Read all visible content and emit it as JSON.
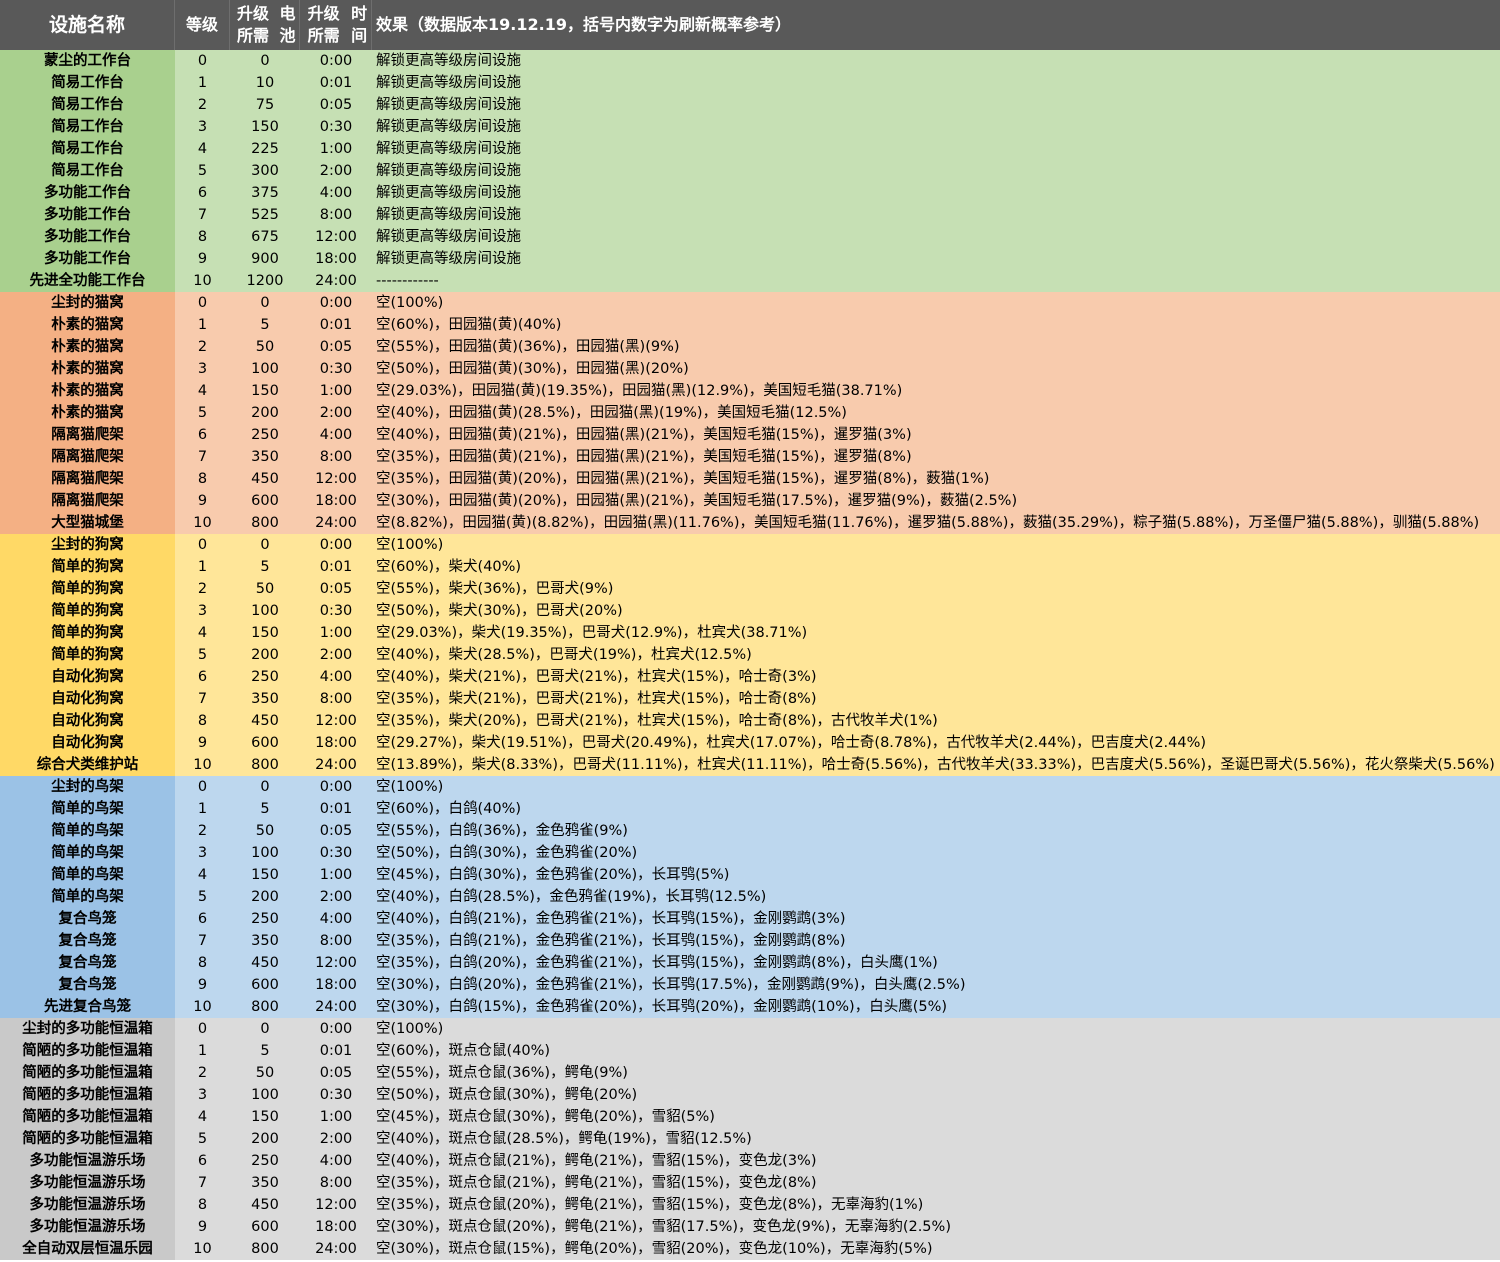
{
  "header": {
    "name": "设施名称",
    "level": "等级",
    "battery_line1": "升级所需",
    "battery_line2": "电池",
    "time_line1": "升级所需",
    "time_line2": "时间",
    "effect": "效果（数据版本19.12.19，括号内数字为刷新概率参考）"
  },
  "groups": [
    {
      "key": "workbench",
      "name_color": "#a9d08e",
      "row_color": "#c6e0b4",
      "rows": [
        {
          "name": "蒙尘的工作台",
          "level": "0",
          "battery": "0",
          "time": "0:00",
          "effect": "解锁更高等级房间设施"
        },
        {
          "name": "简易工作台",
          "level": "1",
          "battery": "10",
          "time": "0:01",
          "effect": "解锁更高等级房间设施"
        },
        {
          "name": "简易工作台",
          "level": "2",
          "battery": "75",
          "time": "0:05",
          "effect": "解锁更高等级房间设施"
        },
        {
          "name": "简易工作台",
          "level": "3",
          "battery": "150",
          "time": "0:30",
          "effect": "解锁更高等级房间设施"
        },
        {
          "name": "简易工作台",
          "level": "4",
          "battery": "225",
          "time": "1:00",
          "effect": "解锁更高等级房间设施"
        },
        {
          "name": "简易工作台",
          "level": "5",
          "battery": "300",
          "time": "2:00",
          "effect": "解锁更高等级房间设施"
        },
        {
          "name": "多功能工作台",
          "level": "6",
          "battery": "375",
          "time": "4:00",
          "effect": "解锁更高等级房间设施"
        },
        {
          "name": "多功能工作台",
          "level": "7",
          "battery": "525",
          "time": "8:00",
          "effect": "解锁更高等级房间设施"
        },
        {
          "name": "多功能工作台",
          "level": "8",
          "battery": "675",
          "time": "12:00",
          "effect": "解锁更高等级房间设施"
        },
        {
          "name": "多功能工作台",
          "level": "9",
          "battery": "900",
          "time": "18:00",
          "effect": "解锁更高等级房间设施"
        },
        {
          "name": "先进全功能工作台",
          "level": "10",
          "battery": "1200",
          "time": "24:00",
          "effect": "------------"
        }
      ]
    },
    {
      "key": "cat",
      "name_color": "#f4b084",
      "row_color": "#f8cbad",
      "rows": [
        {
          "name": "尘封的猫窝",
          "level": "0",
          "battery": "0",
          "time": "0:00",
          "effect": "空(100%)"
        },
        {
          "name": "朴素的猫窝",
          "level": "1",
          "battery": "5",
          "time": "0:01",
          "effect": "空(60%)，田园猫(黄)(40%)"
        },
        {
          "name": "朴素的猫窝",
          "level": "2",
          "battery": "50",
          "time": "0:05",
          "effect": "空(55%)，田园猫(黄)(36%)，田园猫(黑)(9%)"
        },
        {
          "name": "朴素的猫窝",
          "level": "3",
          "battery": "100",
          "time": "0:30",
          "effect": "空(50%)，田园猫(黄)(30%)，田园猫(黑)(20%)"
        },
        {
          "name": "朴素的猫窝",
          "level": "4",
          "battery": "150",
          "time": "1:00",
          "effect": "空(29.03%)，田园猫(黄)(19.35%)，田园猫(黑)(12.9%)，美国短毛猫(38.71%)"
        },
        {
          "name": "朴素的猫窝",
          "level": "5",
          "battery": "200",
          "time": "2:00",
          "effect": "空(40%)，田园猫(黄)(28.5%)，田园猫(黑)(19%)，美国短毛猫(12.5%)"
        },
        {
          "name": "隔离猫爬架",
          "level": "6",
          "battery": "250",
          "time": "4:00",
          "effect": "空(40%)，田园猫(黄)(21%)，田园猫(黑)(21%)，美国短毛猫(15%)，暹罗猫(3%)"
        },
        {
          "name": "隔离猫爬架",
          "level": "7",
          "battery": "350",
          "time": "8:00",
          "effect": "空(35%)，田园猫(黄)(21%)，田园猫(黑)(21%)，美国短毛猫(15%)，暹罗猫(8%)"
        },
        {
          "name": "隔离猫爬架",
          "level": "8",
          "battery": "450",
          "time": "12:00",
          "effect": "空(35%)，田园猫(黄)(20%)，田园猫(黑)(21%)，美国短毛猫(15%)，暹罗猫(8%)，薮猫(1%)"
        },
        {
          "name": "隔离猫爬架",
          "level": "9",
          "battery": "600",
          "time": "18:00",
          "effect": "空(30%)，田园猫(黄)(20%)，田园猫(黑)(21%)，美国短毛猫(17.5%)，暹罗猫(9%)，薮猫(2.5%)"
        },
        {
          "name": "大型猫城堡",
          "level": "10",
          "battery": "800",
          "time": "24:00",
          "effect": "空(8.82%)，田园猫(黄)(8.82%)，田园猫(黑)(11.76%)，美国短毛猫(11.76%)，暹罗猫(5.88%)，薮猫(35.29%)，粽子猫(5.88%)，万圣僵尸猫(5.88%)，驯猫(5.88%)"
        }
      ]
    },
    {
      "key": "dog",
      "name_color": "#ffd966",
      "row_color": "#ffe699",
      "rows": [
        {
          "name": "尘封的狗窝",
          "level": "0",
          "battery": "0",
          "time": "0:00",
          "effect": "空(100%)"
        },
        {
          "name": "简单的狗窝",
          "level": "1",
          "battery": "5",
          "time": "0:01",
          "effect": "空(60%)，柴犬(40%)"
        },
        {
          "name": "简单的狗窝",
          "level": "2",
          "battery": "50",
          "time": "0:05",
          "effect": "空(55%)，柴犬(36%)，巴哥犬(9%)"
        },
        {
          "name": "简单的狗窝",
          "level": "3",
          "battery": "100",
          "time": "0:30",
          "effect": "空(50%)，柴犬(30%)，巴哥犬(20%)"
        },
        {
          "name": "简单的狗窝",
          "level": "4",
          "battery": "150",
          "time": "1:00",
          "effect": "空(29.03%)，柴犬(19.35%)，巴哥犬(12.9%)，杜宾犬(38.71%)"
        },
        {
          "name": "简单的狗窝",
          "level": "5",
          "battery": "200",
          "time": "2:00",
          "effect": "空(40%)，柴犬(28.5%)，巴哥犬(19%)，杜宾犬(12.5%)"
        },
        {
          "name": "自动化狗窝",
          "level": "6",
          "battery": "250",
          "time": "4:00",
          "effect": "空(40%)，柴犬(21%)，巴哥犬(21%)，杜宾犬(15%)，哈士奇(3%)"
        },
        {
          "name": "自动化狗窝",
          "level": "7",
          "battery": "350",
          "time": "8:00",
          "effect": "空(35%)，柴犬(21%)，巴哥犬(21%)，杜宾犬(15%)，哈士奇(8%)"
        },
        {
          "name": "自动化狗窝",
          "level": "8",
          "battery": "450",
          "time": "12:00",
          "effect": "空(35%)，柴犬(20%)，巴哥犬(21%)，杜宾犬(15%)，哈士奇(8%)，古代牧羊犬(1%)"
        },
        {
          "name": "自动化狗窝",
          "level": "9",
          "battery": "600",
          "time": "18:00",
          "effect": "空(29.27%)，柴犬(19.51%)，巴哥犬(20.49%)，杜宾犬(17.07%)，哈士奇(8.78%)，古代牧羊犬(2.44%)，巴吉度犬(2.44%)"
        },
        {
          "name": "综合犬类维护站",
          "level": "10",
          "battery": "800",
          "time": "24:00",
          "effect": "空(13.89%)，柴犬(8.33%)，巴哥犬(11.11%)，杜宾犬(11.11%)，哈士奇(5.56%)，古代牧羊犬(33.33%)，巴吉度犬(5.56%)，圣诞巴哥犬(5.56%)，花火祭柴犬(5.56%)"
        }
      ]
    },
    {
      "key": "bird",
      "name_color": "#9bc2e6",
      "row_color": "#bdd7ee",
      "rows": [
        {
          "name": "尘封的鸟架",
          "level": "0",
          "battery": "0",
          "time": "0:00",
          "effect": "空(100%)"
        },
        {
          "name": "简单的鸟架",
          "level": "1",
          "battery": "5",
          "time": "0:01",
          "effect": "空(60%)，白鸽(40%)"
        },
        {
          "name": "简单的鸟架",
          "level": "2",
          "battery": "50",
          "time": "0:05",
          "effect": "空(55%)，白鸽(36%)，金色鸦雀(9%)"
        },
        {
          "name": "简单的鸟架",
          "level": "3",
          "battery": "100",
          "time": "0:30",
          "effect": "空(50%)，白鸽(30%)，金色鸦雀(20%)"
        },
        {
          "name": "简单的鸟架",
          "level": "4",
          "battery": "150",
          "time": "1:00",
          "effect": "空(45%)，白鸽(30%)，金色鸦雀(20%)，长耳鸮(5%)"
        },
        {
          "name": "简单的鸟架",
          "level": "5",
          "battery": "200",
          "time": "2:00",
          "effect": "空(40%)，白鸽(28.5%)，金色鸦雀(19%)，长耳鸮(12.5%)"
        },
        {
          "name": "复合鸟笼",
          "level": "6",
          "battery": "250",
          "time": "4:00",
          "effect": "空(40%)，白鸽(21%)，金色鸦雀(21%)，长耳鸮(15%)，金刚鹦鹉(3%)"
        },
        {
          "name": "复合鸟笼",
          "level": "7",
          "battery": "350",
          "time": "8:00",
          "effect": "空(35%)，白鸽(21%)，金色鸦雀(21%)，长耳鸮(15%)，金刚鹦鹉(8%)"
        },
        {
          "name": "复合鸟笼",
          "level": "8",
          "battery": "450",
          "time": "12:00",
          "effect": "空(35%)，白鸽(20%)，金色鸦雀(21%)，长耳鸮(15%)，金刚鹦鹉(8%)，白头鹰(1%)"
        },
        {
          "name": "复合鸟笼",
          "level": "9",
          "battery": "600",
          "time": "18:00",
          "effect": "空(30%)，白鸽(20%)，金色鸦雀(21%)，长耳鸮(17.5%)，金刚鹦鹉(9%)，白头鹰(2.5%)"
        },
        {
          "name": "先进复合鸟笼",
          "level": "10",
          "battery": "800",
          "time": "24:00",
          "effect": "空(30%)，白鸽(15%)，金色鸦雀(20%)，长耳鸮(20%)，金刚鹦鹉(10%)，白头鹰(5%)"
        }
      ]
    },
    {
      "key": "terrarium",
      "name_color": "#c9c9c9",
      "row_color": "#dbdbdb",
      "rows": [
        {
          "name": "尘封的多功能恒温箱",
          "level": "0",
          "battery": "0",
          "time": "0:00",
          "effect": "空(100%)"
        },
        {
          "name": "简陋的多功能恒温箱",
          "level": "1",
          "battery": "5",
          "time": "0:01",
          "effect": "空(60%)，斑点仓鼠(40%)"
        },
        {
          "name": "简陋的多功能恒温箱",
          "level": "2",
          "battery": "50",
          "time": "0:05",
          "effect": "空(55%)，斑点仓鼠(36%)，鳄龟(9%)"
        },
        {
          "name": "简陋的多功能恒温箱",
          "level": "3",
          "battery": "100",
          "time": "0:30",
          "effect": "空(50%)，斑点仓鼠(30%)，鳄龟(20%)"
        },
        {
          "name": "简陋的多功能恒温箱",
          "level": "4",
          "battery": "150",
          "time": "1:00",
          "effect": "空(45%)，斑点仓鼠(30%)，鳄龟(20%)，雪貂(5%)"
        },
        {
          "name": "简陋的多功能恒温箱",
          "level": "5",
          "battery": "200",
          "time": "2:00",
          "effect": "空(40%)，斑点仓鼠(28.5%)，鳄龟(19%)，雪貂(12.5%)"
        },
        {
          "name": "多功能恒温游乐场",
          "level": "6",
          "battery": "250",
          "time": "4:00",
          "effect": "空(40%)，斑点仓鼠(21%)，鳄龟(21%)，雪貂(15%)，变色龙(3%)"
        },
        {
          "name": "多功能恒温游乐场",
          "level": "7",
          "battery": "350",
          "time": "8:00",
          "effect": "空(35%)，斑点仓鼠(21%)，鳄龟(21%)，雪貂(15%)，变色龙(8%)"
        },
        {
          "name": "多功能恒温游乐场",
          "level": "8",
          "battery": "450",
          "time": "12:00",
          "effect": "空(35%)，斑点仓鼠(20%)，鳄龟(21%)，雪貂(15%)，变色龙(8%)，无辜海豹(1%)"
        },
        {
          "name": "多功能恒温游乐场",
          "level": "9",
          "battery": "600",
          "time": "18:00",
          "effect": "空(30%)，斑点仓鼠(20%)，鳄龟(21%)，雪貂(17.5%)，变色龙(9%)，无辜海豹(2.5%)"
        },
        {
          "name": "全自动双层恒温乐园",
          "level": "10",
          "battery": "800",
          "time": "24:00",
          "effect": "空(30%)，斑点仓鼠(15%)，鳄龟(20%)，雪貂(20%)，变色龙(10%)，无辜海豹(5%)"
        }
      ]
    }
  ]
}
